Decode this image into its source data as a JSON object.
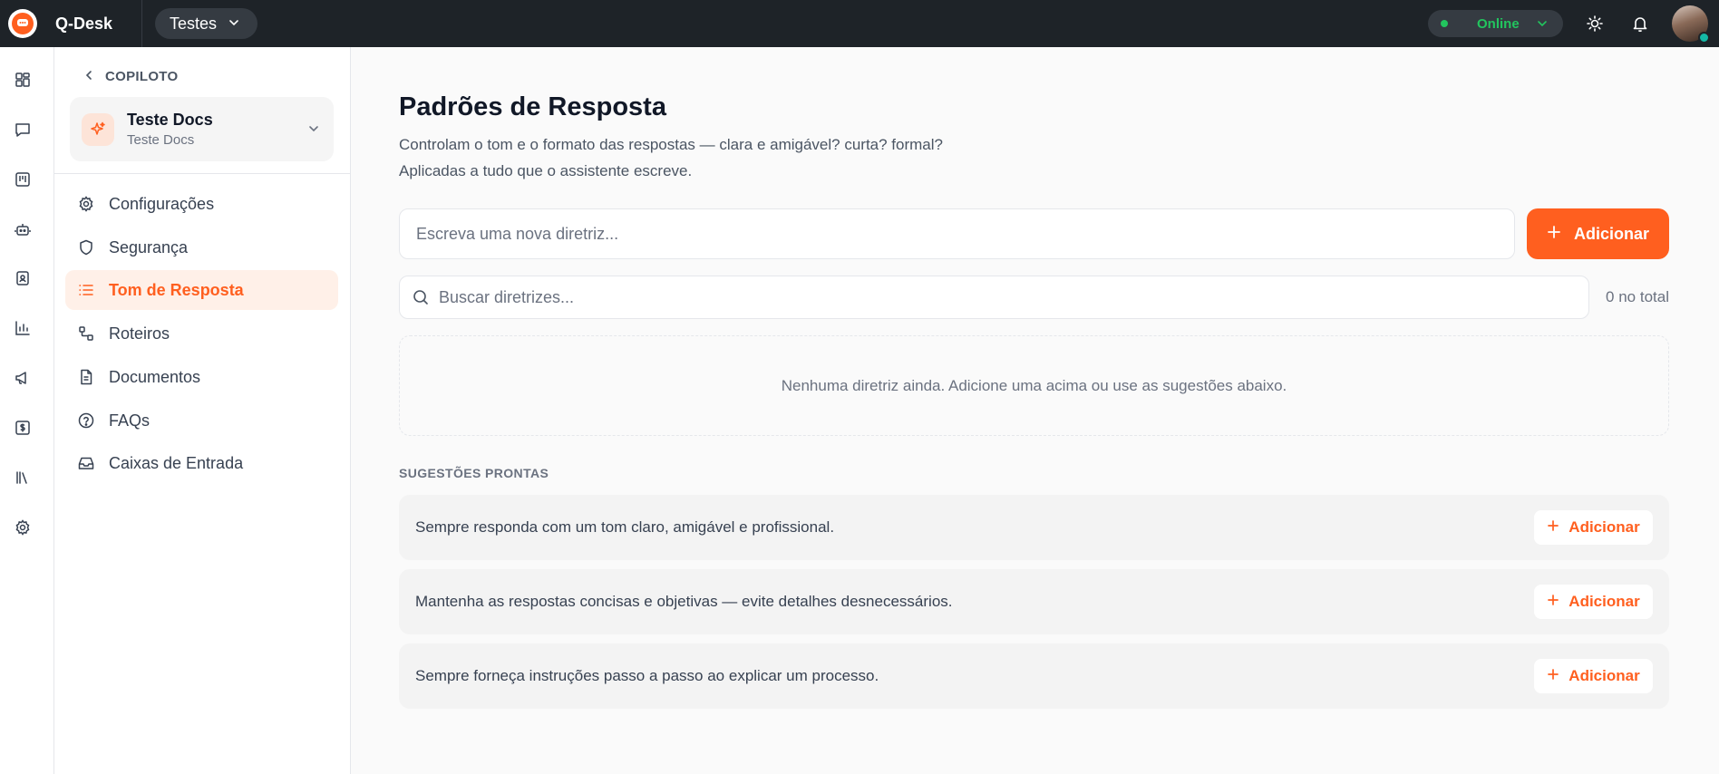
{
  "app": {
    "name": "Q-Desk",
    "workspace": "Testes"
  },
  "topbar": {
    "status": "Online",
    "colors": {
      "status": "#22c55e",
      "accent": "#ff5f1f",
      "bar": "#1e2328"
    }
  },
  "rail": {
    "items": [
      "dashboard-icon",
      "chat-icon",
      "kanban-icon",
      "bot-icon",
      "contacts-icon",
      "reports-icon",
      "campaigns-icon",
      "billing-icon",
      "library-icon",
      "settings-icon"
    ]
  },
  "subnav": {
    "back_label": "COPILOTO",
    "bot": {
      "name": "Teste Docs",
      "subtitle": "Teste Docs"
    },
    "items": [
      {
        "label": "Configurações",
        "icon": "gear-icon"
      },
      {
        "label": "Segurança",
        "icon": "shield-icon"
      },
      {
        "label": "Tom de Resposta",
        "icon": "list-icon",
        "active": true
      },
      {
        "label": "Roteiros",
        "icon": "route-icon"
      },
      {
        "label": "Documentos",
        "icon": "document-icon"
      },
      {
        "label": "FAQs",
        "icon": "help-icon"
      },
      {
        "label": "Caixas de Entrada",
        "icon": "inbox-icon"
      }
    ]
  },
  "main": {
    "title": "Padrões de Resposta",
    "description_line1": "Controlam o tom e o formato das respostas — clara e amigável? curta? formal?",
    "description_line2": "Aplicadas a tudo que o assistente escreve.",
    "new_placeholder": "Escreva uma nova diretriz...",
    "add_label": "Adicionar",
    "search_placeholder": "Buscar diretrizes...",
    "total_label": "0 no total",
    "empty_message": "Nenhuma diretriz ainda. Adicione uma acima ou use as sugestões abaixo.",
    "suggestions_heading": "SUGESTÕES PRONTAS",
    "suggestions": [
      {
        "text": "Sempre responda com um tom claro, amigável e profissional.",
        "button": "Adicionar"
      },
      {
        "text": "Mantenha as respostas concisas e objetivas — evite detalhes desnecessários.",
        "button": "Adicionar"
      },
      {
        "text": "Sempre forneça instruções passo a passo ao explicar um processo.",
        "button": "Adicionar"
      }
    ]
  }
}
